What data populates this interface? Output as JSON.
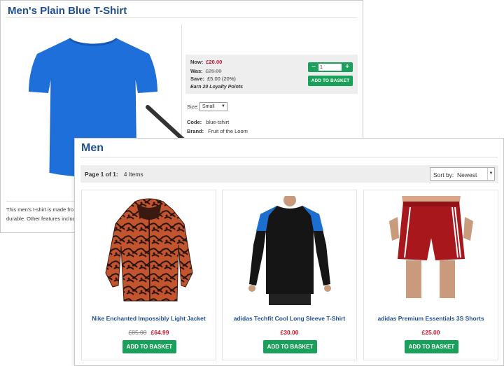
{
  "product_page": {
    "title": "Men's Plain Blue T-Shirt",
    "price_box": {
      "now_label": "Now:",
      "now_value": "£20.00",
      "was_label": "Was:",
      "was_value": "£25.00",
      "save_label": "Save:",
      "save_value": "£5.00 (20%)",
      "loyalty": "Earn 20 Loyalty Points"
    },
    "quantity": {
      "minus": "−",
      "value": "1",
      "plus": "+"
    },
    "add_to_basket": "ADD TO BASKET",
    "size_label": "Size:",
    "size_value": "Small",
    "code_label": "Code:",
    "code_value": "blue-tshirt",
    "brand_label": "Brand:",
    "brand_value": "Fruit of the Loom",
    "description_line1": "This men's t-shirt is made fro",
    "description_line2": "durable. Other features includ",
    "product_color": "#1e6fd9"
  },
  "category_page": {
    "title": "Men",
    "pager": {
      "page_label": "Page 1 of 1:",
      "items_count": "4 Items"
    },
    "sort": {
      "label": "Sort by:",
      "value": "Newest"
    },
    "products": [
      {
        "name": "Nike Enchanted Impossibly Light Jacket",
        "old_price": "£85.00",
        "price": "£64.99",
        "button": "ADD TO BASKET",
        "image": "orange-black-jacket"
      },
      {
        "name": "adidas Techfit Cool Long Sleeve T-Shirt",
        "old_price": "",
        "price": "£30.00",
        "button": "ADD TO BASKET",
        "image": "black-blue-long-sleeve-top"
      },
      {
        "name": "adidas Premium Essentials 3S Shorts",
        "old_price": "",
        "price": "£25.00",
        "button": "ADD TO BASKET",
        "image": "red-shorts"
      }
    ]
  },
  "colors": {
    "brand_blue": "#1f4e8c",
    "price_red": "#c8102e",
    "button_green": "#1aa05a"
  }
}
